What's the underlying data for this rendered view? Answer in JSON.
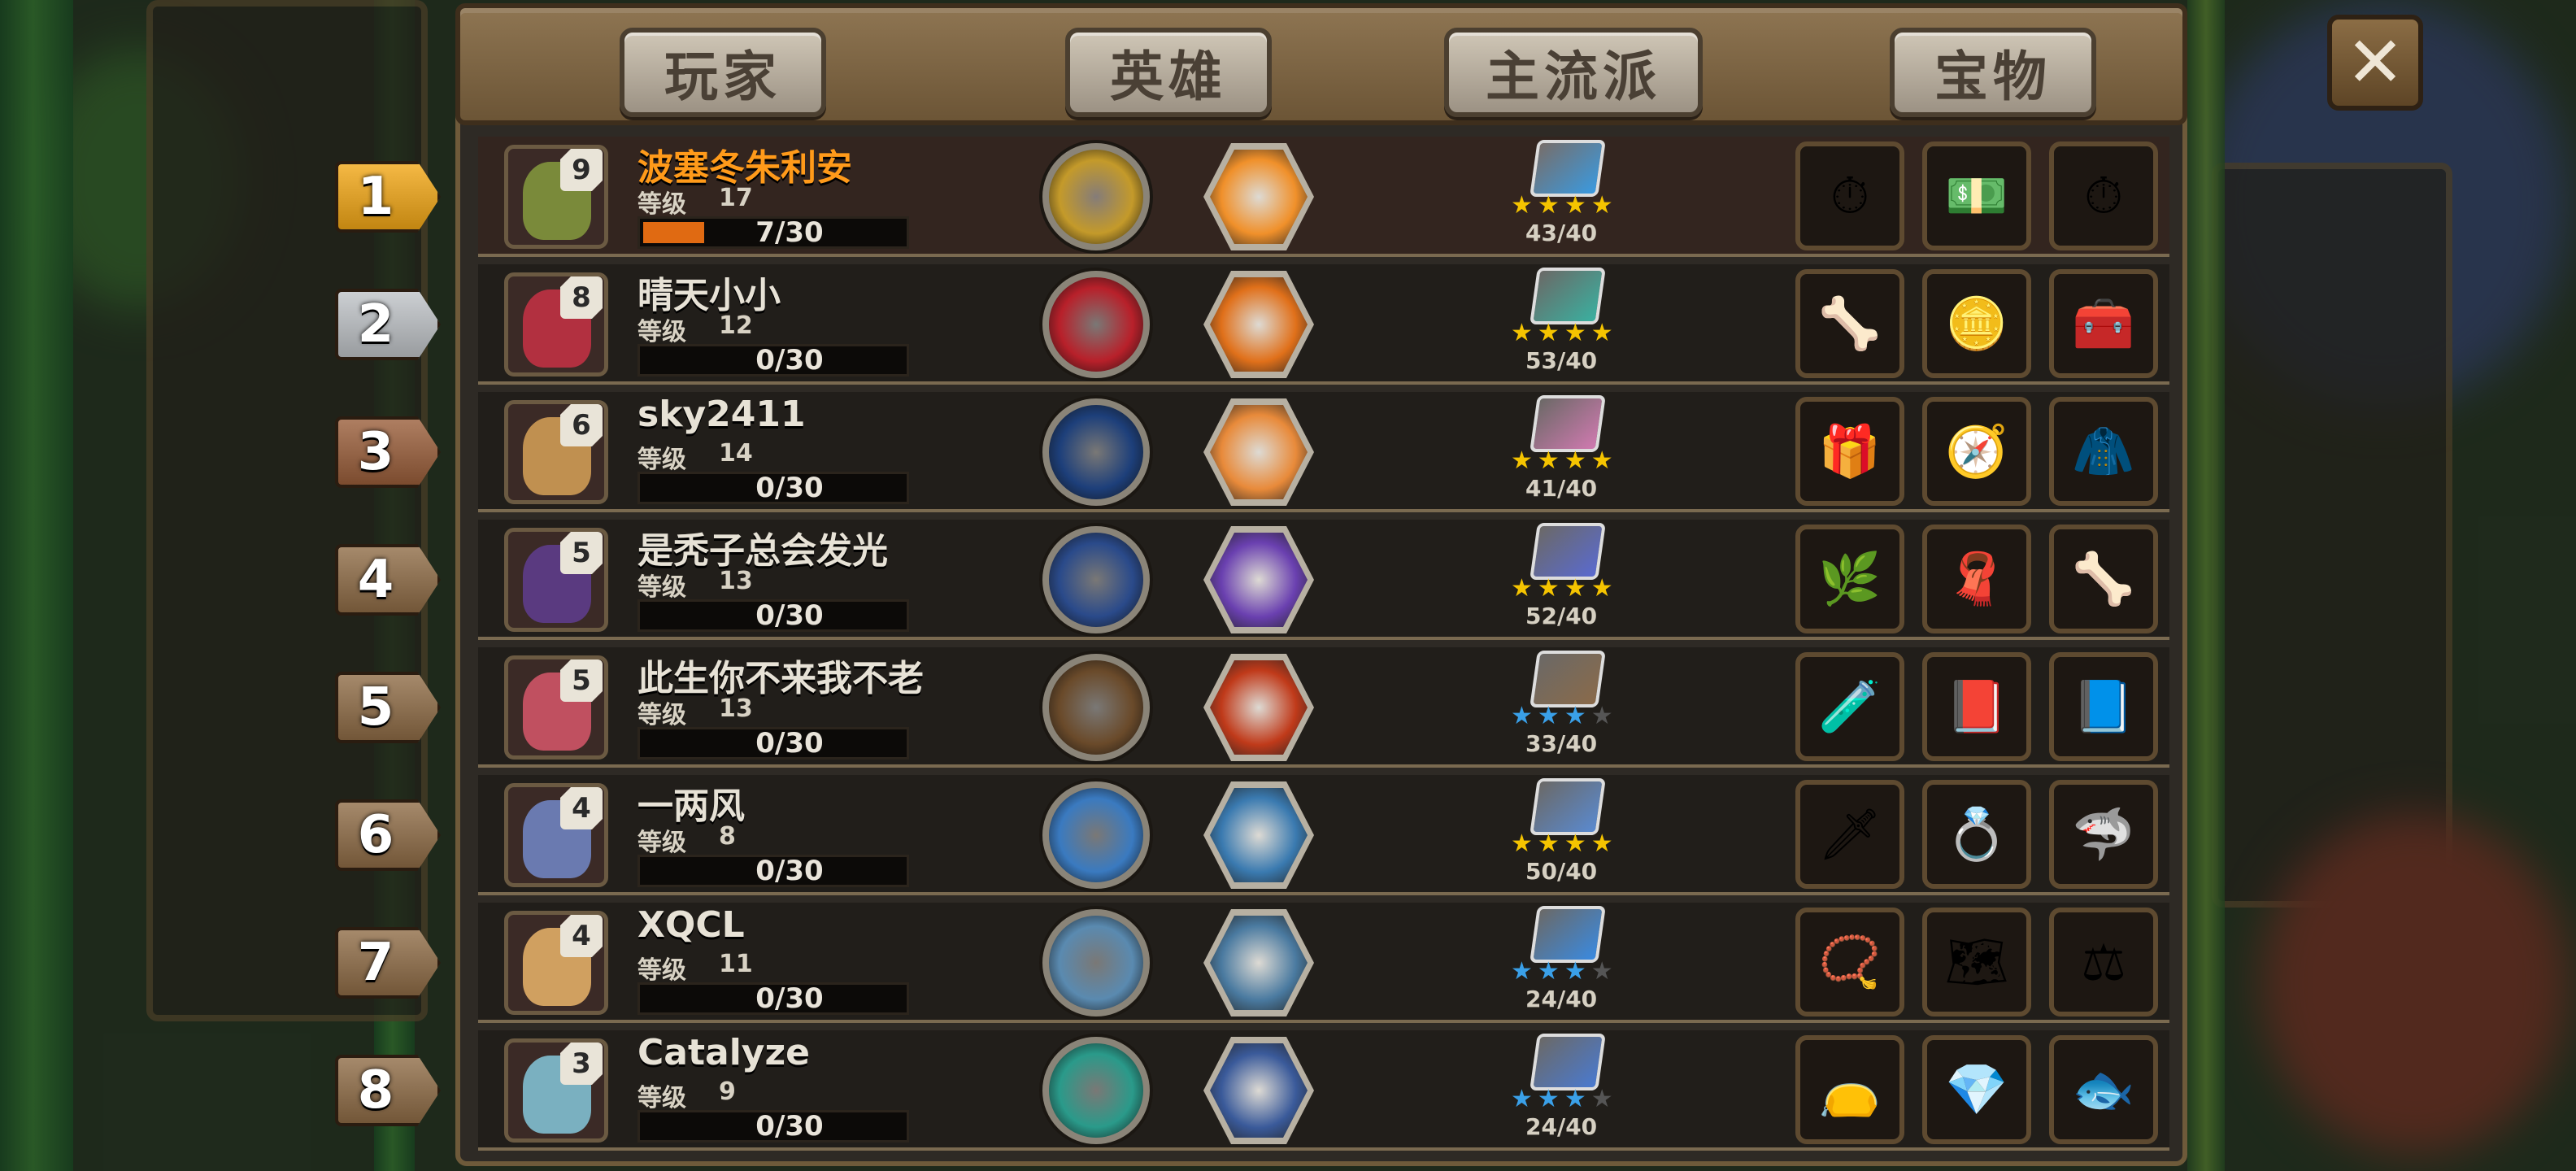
{
  "tabs": {
    "player": "玩家",
    "hero": "英雄",
    "school": "主流派",
    "treasure": "宝物"
  },
  "close_label": "✕",
  "level_label": "等级",
  "rows": [
    {
      "rank": "1",
      "avatar_level": "9",
      "name": "波塞冬朱利安",
      "level": "17",
      "xp": "7/30",
      "xp_fill": 0.23,
      "school": "43/40",
      "stars": [
        "★",
        "★",
        "★",
        "★"
      ],
      "star_colors": [
        "#f5c400",
        "#f5c400",
        "#f5c400",
        "#f5c400"
      ],
      "treasures": [
        "⏱",
        "💵",
        "⏱"
      ]
    },
    {
      "rank": "2",
      "avatar_level": "8",
      "name": "晴天小小",
      "level": "12",
      "xp": "0/30",
      "xp_fill": 0,
      "school": "53/40",
      "stars": [
        "★",
        "★",
        "★",
        "★"
      ],
      "star_colors": [
        "#f5c400",
        "#f5c400",
        "#f5c400",
        "#f5c400"
      ],
      "treasures": [
        "🦴",
        "🪙",
        "🧰"
      ]
    },
    {
      "rank": "3",
      "avatar_level": "6",
      "name": "sky2411",
      "level": "14",
      "xp": "0/30",
      "xp_fill": 0,
      "school": "41/40",
      "stars": [
        "★",
        "★",
        "★",
        "★"
      ],
      "star_colors": [
        "#f5c400",
        "#f5c400",
        "#f5c400",
        "#f5c400"
      ],
      "treasures": [
        "🎁",
        "🧭",
        "🧥"
      ]
    },
    {
      "rank": "4",
      "avatar_level": "5",
      "name": "是秃子总会发光",
      "level": "13",
      "xp": "0/30",
      "xp_fill": 0,
      "school": "52/40",
      "stars": [
        "★",
        "★",
        "★",
        "★"
      ],
      "star_colors": [
        "#f5c400",
        "#f5c400",
        "#f5c400",
        "#f5c400"
      ],
      "treasures": [
        "🌿",
        "🧣",
        "🦴"
      ]
    },
    {
      "rank": "5",
      "avatar_level": "5",
      "name": "此生你不来我不老",
      "level": "13",
      "xp": "0/30",
      "xp_fill": 0,
      "school": "33/40",
      "stars": [
        "★",
        "★",
        "★",
        "★"
      ],
      "star_colors": [
        "#3aa0e8",
        "#3aa0e8",
        "#3aa0e8",
        "#555"
      ],
      "treasures": [
        "🧪",
        "📕",
        "📘"
      ]
    },
    {
      "rank": "6",
      "avatar_level": "4",
      "name": "一两风",
      "level": "8",
      "xp": "0/30",
      "xp_fill": 0,
      "school": "50/40",
      "stars": [
        "★",
        "★",
        "★",
        "★"
      ],
      "star_colors": [
        "#f5c400",
        "#f5c400",
        "#f5c400",
        "#f5c400"
      ],
      "treasures": [
        "🗡",
        "💍",
        "🦈"
      ]
    },
    {
      "rank": "7",
      "avatar_level": "4",
      "name": "XQCL",
      "level": "11",
      "xp": "0/30",
      "xp_fill": 0,
      "school": "24/40",
      "stars": [
        "★",
        "★",
        "★",
        "★"
      ],
      "star_colors": [
        "#3aa0e8",
        "#3aa0e8",
        "#3aa0e8",
        "#555"
      ],
      "treasures": [
        "📿",
        "🗺",
        "⚖"
      ]
    },
    {
      "rank": "8",
      "avatar_level": "3",
      "name": "Catalyze",
      "level": "9",
      "xp": "0/30",
      "xp_fill": 0,
      "school": "24/40",
      "stars": [
        "★",
        "★",
        "★",
        "★"
      ],
      "star_colors": [
        "#3aa0e8",
        "#3aa0e8",
        "#3aa0e8",
        "#555"
      ],
      "treasures": [
        "👝",
        "💎",
        "🐟"
      ]
    }
  ],
  "rank_colors": [
    "#f2a716",
    "#bfc3c7",
    "#9a5e3a",
    "#8f6c46",
    "#8f6c46",
    "#8f6c46",
    "#8f6c46",
    "#8f6c46"
  ],
  "avatar_colors": [
    "#7a8a3a",
    "#b23040",
    "#c09050",
    "#5a3a80",
    "#c05060",
    "#6a7ab0",
    "#d0a060",
    "#7ab0c0"
  ],
  "hero_circle_colors": [
    "#c49a2a",
    "#b8202a",
    "#1d3f7a",
    "#2a4a8a",
    "#6a4a2a",
    "#3a7ac0",
    "#5a8ab0",
    "#2a9a8a"
  ],
  "hero_hex_colors": [
    "#f0902a",
    "#e0701a",
    "#e88a3a",
    "#6a40b0",
    "#c03a1a",
    "#3a7ab0",
    "#4a7aa0",
    "#3a5a9a"
  ],
  "book_colors": [
    "#3a9ae0",
    "#3ab0a0",
    "#d07ab0",
    "#5a6ad0",
    "#8a6a4a",
    "#5a8ad0",
    "#3a8ae0",
    "#4a7ad0"
  ]
}
